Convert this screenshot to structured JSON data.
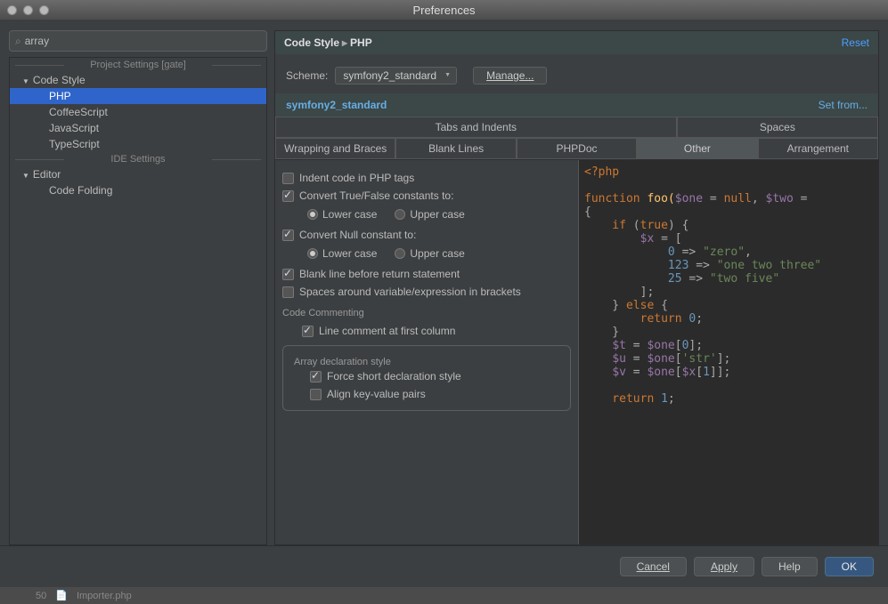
{
  "window": {
    "title": "Preferences"
  },
  "search": {
    "value": "array",
    "placeholder": ""
  },
  "sidebar": {
    "section1": "Project Settings [gate]",
    "section2": "IDE Settings",
    "items1": {
      "codeStyle": "Code Style",
      "php": "PHP",
      "coffee": "CoffeeScript",
      "js": "JavaScript",
      "ts": "TypeScript"
    },
    "items2": {
      "editor": "Editor",
      "codeFolding": "Code Folding"
    }
  },
  "breadcrumb": {
    "part1": "Code Style",
    "part2": "PHP"
  },
  "reset": "Reset",
  "scheme": {
    "label": "Scheme:",
    "value": "symfony2_standard",
    "manage": "Manage..."
  },
  "schemeName": "symfony2_standard",
  "setFrom": "Set from...",
  "tabs": {
    "r1": {
      "tabsIndents": "Tabs and Indents",
      "spaces": "Spaces"
    },
    "r2": {
      "wrapping": "Wrapping and Braces",
      "blankLines": "Blank Lines",
      "phpdoc": "PHPDoc",
      "other": "Other",
      "arrangement": "Arrangement"
    }
  },
  "options": {
    "indentPhp": "Indent code in PHP tags",
    "convertTrueFalse": "Convert True/False constants to:",
    "lower": "Lower case",
    "upper": "Upper case",
    "convertNull": "Convert Null constant to:",
    "blankBeforeReturn": "Blank line before return statement",
    "spacesBrackets": "Spaces around variable/expression in brackets",
    "codeCommenting": "Code Commenting",
    "lineCommentFirst": "Line comment at first column",
    "arrayDecl": "Array declaration style",
    "forceShort": "Force short declaration style",
    "alignKV": "Align key-value pairs"
  },
  "footer": {
    "cancel": "Cancel",
    "apply": "Apply",
    "help": "Help",
    "ok": "OK"
  },
  "bgstrip": {
    "num": "50",
    "file": "Importer.php"
  },
  "preview": {
    "l1a": "<?php",
    "l2a": "function",
    "l2b": " foo(",
    "l2c": "$one",
    "l2d": " = ",
    "l2e": "null",
    "l2f": ", ",
    "l2g": "$two",
    "l2h": " =",
    "l3": "{",
    "l4a": "    if ",
    "l4b": "(",
    "l4c": "true",
    "l4d": ") {",
    "l5a": "        ",
    "l5b": "$x",
    "l5c": " = [",
    "l6a": "            ",
    "l6b": "0",
    "l6c": " => ",
    "l6d": "\"zero\"",
    "l6e": ",",
    "l7a": "            ",
    "l7b": "123",
    "l7c": " => ",
    "l7d": "\"one two three\"",
    "l8a": "            ",
    "l8b": "25",
    "l8c": " => ",
    "l8d": "\"two five\"",
    "l9": "        ];",
    "l10a": "    } ",
    "l10b": "else",
    "l10c": " {",
    "l11a": "        return ",
    "l11b": "0",
    "l11c": ";",
    "l12": "    }",
    "l13a": "    ",
    "l13b": "$t",
    "l13c": " = ",
    "l13d": "$one",
    "l13e": "[",
    "l13f": "0",
    "l13g": "];",
    "l14a": "    ",
    "l14b": "$u",
    "l14c": " = ",
    "l14d": "$one",
    "l14e": "[",
    "l14f": "'str'",
    "l14g": "];",
    "l15a": "    ",
    "l15b": "$v",
    "l15c": " = ",
    "l15d": "$one",
    "l15e": "[",
    "l15f": "$x",
    "l15g": "[",
    "l15h": "1",
    "l15i": "]];",
    "l16a": "    return ",
    "l16b": "1",
    "l16c": ";"
  }
}
